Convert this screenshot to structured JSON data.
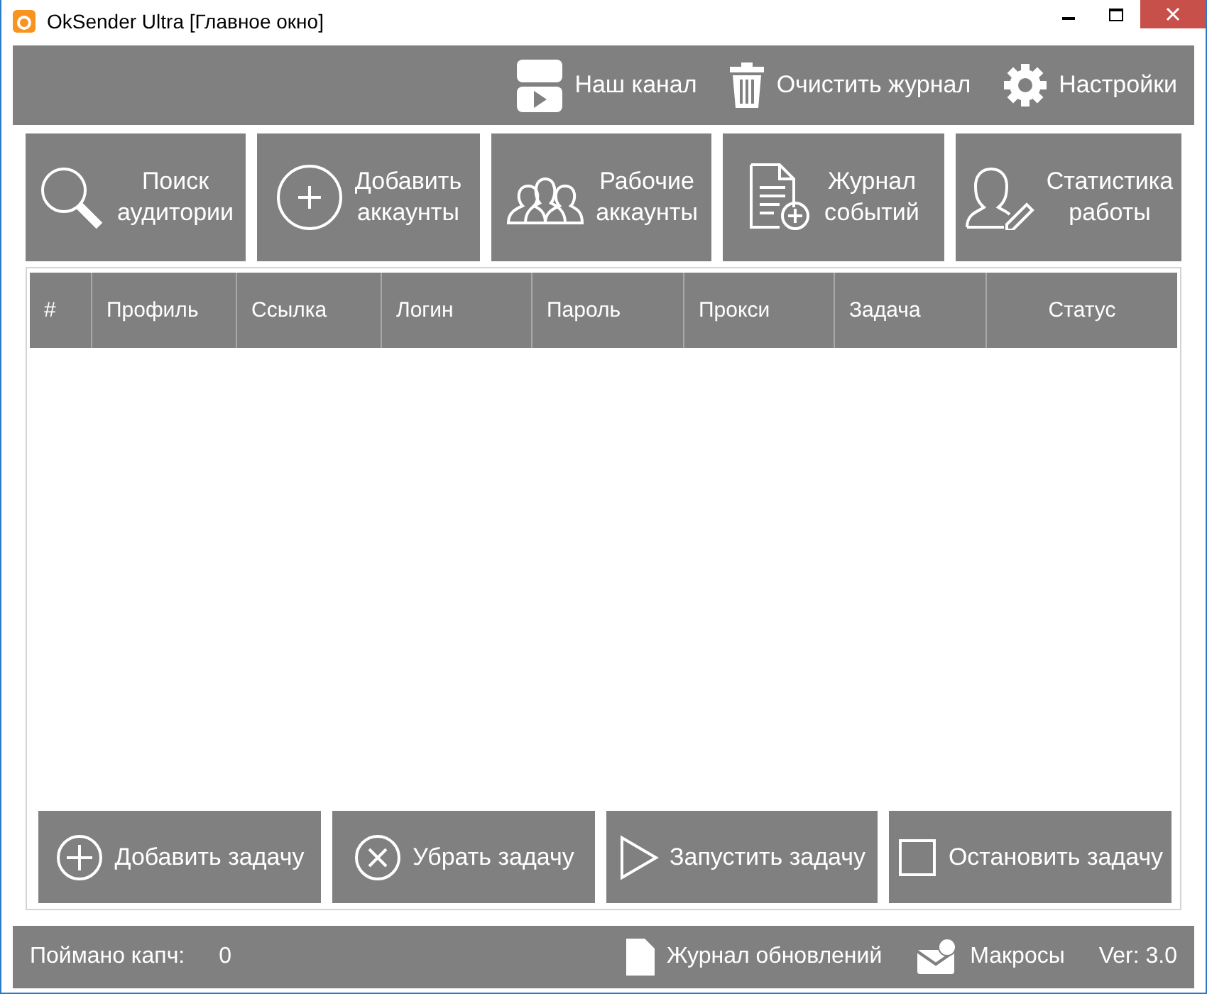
{
  "window": {
    "title": "OkSender Ultra [Главное окно]"
  },
  "toolbar": [
    {
      "label": "Наш канал"
    },
    {
      "label": "Очистить журнал"
    },
    {
      "label": "Настройки"
    }
  ],
  "actions": [
    {
      "lines": [
        "Поиск",
        "аудитории"
      ]
    },
    {
      "lines": [
        "Добавить",
        "аккаунты"
      ]
    },
    {
      "lines": [
        "Рабочие",
        "аккаунты"
      ]
    },
    {
      "lines": [
        "Журнал",
        "событий"
      ]
    },
    {
      "lines": [
        "Статистика",
        "работы"
      ]
    }
  ],
  "table": {
    "columns": [
      "#",
      "Профиль",
      "Ссылка",
      "Логин",
      "Пароль",
      "Прокси",
      "Задача",
      "Статус"
    ]
  },
  "task_buttons": [
    {
      "label": "Добавить задачу"
    },
    {
      "label": "Убрать задачу"
    },
    {
      "label": "Запустить задачу"
    },
    {
      "label": "Остановить задачу"
    }
  ],
  "status_bar": {
    "captcha_label": "Поймано капч:",
    "captcha_count": "0",
    "updates": "Журнал обновлений",
    "macros": "Макросы",
    "version": "Ver: 3.0"
  }
}
